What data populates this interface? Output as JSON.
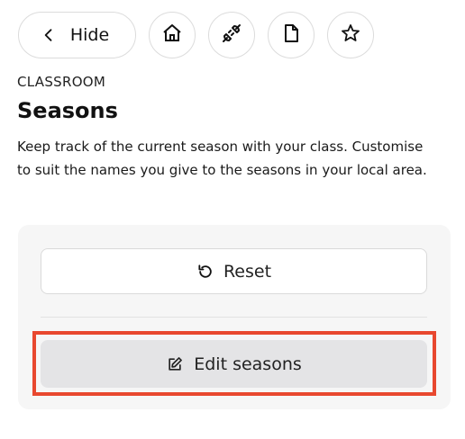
{
  "toolbar": {
    "hide_label": "Hide",
    "icons": [
      "chevron-left-icon",
      "home-icon",
      "plug-icon",
      "document-icon",
      "star-icon"
    ]
  },
  "header": {
    "eyebrow": "CLASSROOM",
    "title": "Seasons",
    "description": "Keep track of the current season with your class. Customise to suit the names you give to the seasons in your local area."
  },
  "panel": {
    "reset_label": "Reset",
    "edit_label": "Edit seasons",
    "highlight_color": "#e8482f"
  }
}
